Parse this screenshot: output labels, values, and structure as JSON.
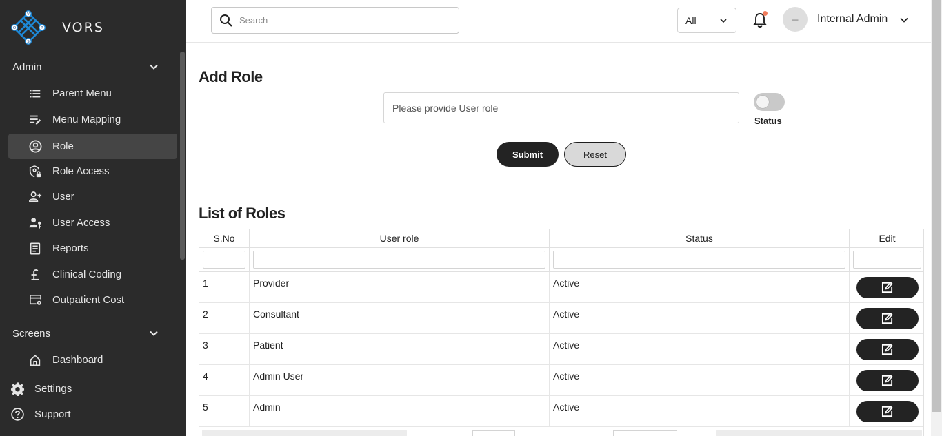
{
  "brand": {
    "name": "VORS",
    "logo_letters": [
      "V",
      "O",
      "R",
      "S"
    ]
  },
  "sidebar": {
    "sections": [
      {
        "title": "Admin",
        "items": [
          {
            "label": "Parent Menu",
            "icon": "list-icon"
          },
          {
            "label": "Menu Mapping",
            "icon": "list-edit-icon"
          },
          {
            "label": "Role",
            "icon": "account-circle-icon",
            "active": true
          },
          {
            "label": "Role Access",
            "icon": "shield-lock-icon"
          },
          {
            "label": "User",
            "icon": "person-add-icon"
          },
          {
            "label": "User Access",
            "icon": "person-key-icon"
          },
          {
            "label": "Reports",
            "icon": "report-icon"
          },
          {
            "label": "Clinical Coding",
            "icon": "pound-icon"
          },
          {
            "label": "Outpatient Cost",
            "icon": "card-gear-icon"
          }
        ]
      },
      {
        "title": "Screens",
        "items": [
          {
            "label": "Dashboard",
            "icon": "home-icon"
          }
        ]
      }
    ],
    "root_items": [
      {
        "label": "Settings",
        "icon": "gear-icon"
      },
      {
        "label": "Support",
        "icon": "help-icon"
      }
    ]
  },
  "header": {
    "search_placeholder": "Search",
    "scope_value": "All",
    "user_name": "Internal Admin",
    "notification_dot_color": "#f07b5b"
  },
  "form": {
    "title": "Add Role",
    "role_placeholder": "Please provide User role",
    "status_label": "Status",
    "status_on": false,
    "submit_label": "Submit",
    "reset_label": "Reset"
  },
  "list": {
    "title": "List of Roles",
    "columns": [
      "S.No",
      "User role",
      "Status",
      "Edit"
    ],
    "rows": [
      {
        "sno": "1",
        "role": "Provider",
        "status": "Active"
      },
      {
        "sno": "2",
        "role": "Consultant",
        "status": "Active"
      },
      {
        "sno": "3",
        "role": "Patient",
        "status": "Active"
      },
      {
        "sno": "4",
        "role": "Admin User",
        "status": "Active"
      },
      {
        "sno": "5",
        "role": "Admin",
        "status": "Active"
      }
    ]
  },
  "colors": {
    "sidebar_bg": "#2b2b2b",
    "logo_blue": "#1e88d6",
    "primary_dark": "#232323"
  }
}
